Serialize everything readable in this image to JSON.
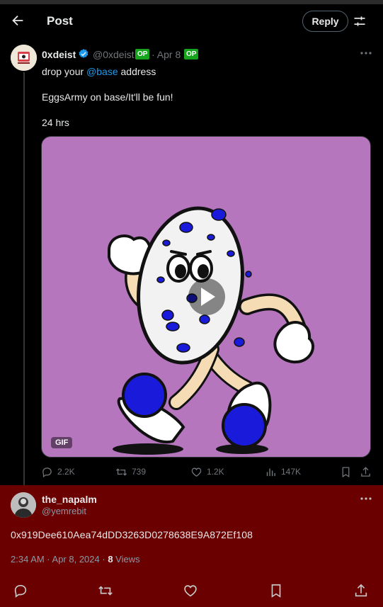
{
  "header": {
    "title": "Post",
    "reply_label": "Reply"
  },
  "post": {
    "author_name": "0xdeist",
    "author_handle": "@0xdeist",
    "op_badge": "OP",
    "date": "· Apr 8",
    "text_prefix": "drop your ",
    "mention": "@base",
    "text_suffix": " address",
    "line2": "EggsArmy on base/It'll be fun!",
    "line3": "24 hrs",
    "gif_label": "GIF",
    "stats": {
      "replies": "2.2K",
      "reposts": "739",
      "likes": "1.2K",
      "views": "147K"
    }
  },
  "reply": {
    "author_name": "the_napalm",
    "author_handle": "@yemrebit",
    "text": "0x919Dee610Aea74dDD3263D0278638E9A872Ef108",
    "timestamp": "2:34 AM · Apr 8, 2024 · ",
    "views_count": "8",
    "views_label": " Views"
  },
  "colors": {
    "accent": "#1d9bf0",
    "op_badge": "#17a41d",
    "reply_background": "#6b0000",
    "media_background": "#b576be"
  }
}
